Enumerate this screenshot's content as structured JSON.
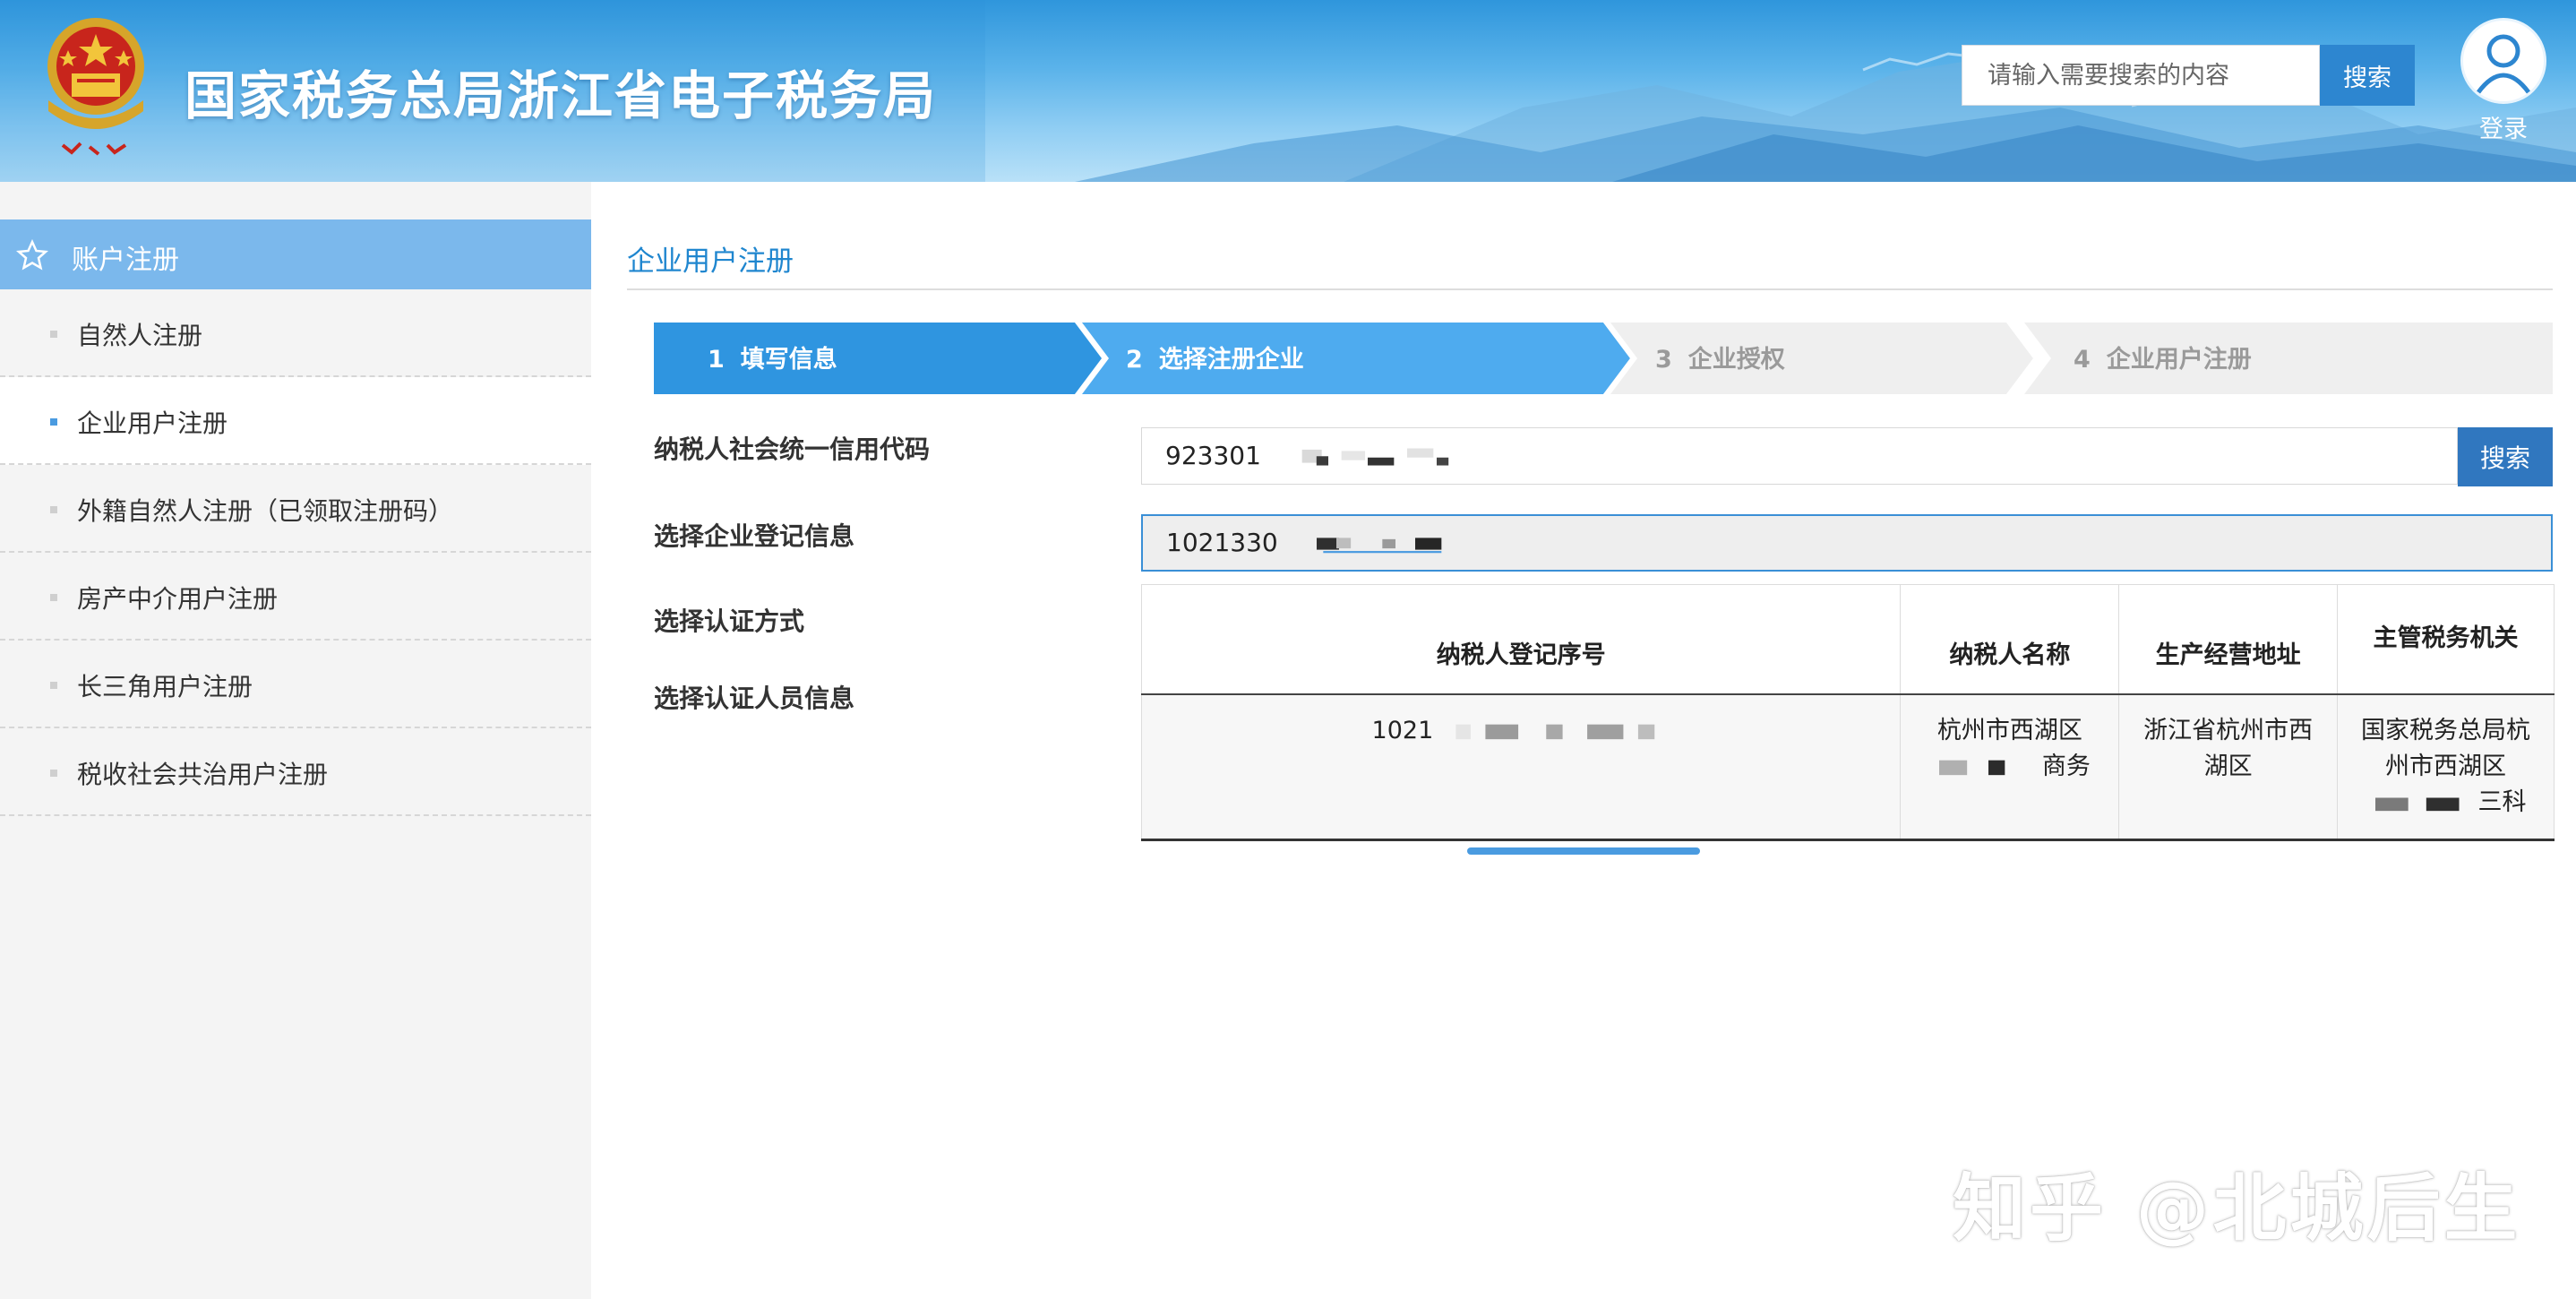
{
  "header": {
    "title": "国家税务总局浙江省电子税务局",
    "search_placeholder": "请输入需要搜索的内容",
    "search_button": "搜索",
    "login_label": "登录"
  },
  "sidebar": {
    "heading": "账户注册",
    "items": [
      {
        "label": "自然人注册",
        "active": false
      },
      {
        "label": "企业用户注册",
        "active": true
      },
      {
        "label": "外籍自然人注册（已领取注册码）",
        "active": false
      },
      {
        "label": "房产中介用户注册",
        "active": false
      },
      {
        "label": "长三角用户注册",
        "active": false
      },
      {
        "label": "税收社会共治用户注册",
        "active": false
      }
    ]
  },
  "main": {
    "section_title": "企业用户注册",
    "steps": [
      {
        "num": "1",
        "label": "填写信息",
        "state": "done"
      },
      {
        "num": "2",
        "label": "选择注册企业",
        "state": "current"
      },
      {
        "num": "3",
        "label": "企业授权",
        "state": "pending"
      },
      {
        "num": "4",
        "label": "企业用户注册",
        "state": "pending"
      }
    ],
    "form": {
      "credit_code_label": "纳税人社会统一信用代码",
      "credit_code_value": "923301",
      "credit_code_search": "搜索",
      "reg_info_label": "选择企业登记信息",
      "reg_info_value": "1021330",
      "auth_method_label": "选择认证方式",
      "auth_person_label": "选择认证人员信息"
    },
    "table": {
      "headers": [
        "纳税人登记序号",
        "纳税人名称",
        "生产经营地址",
        "主管税务机关"
      ],
      "rows": [
        {
          "reg_no": "1021",
          "name_lines": [
            "杭州市西湖区",
            "商务"
          ],
          "address_lines": [
            "浙江省杭州市西",
            "湖区"
          ],
          "authority_lines": [
            "国家税务总局杭",
            "州市西湖区",
            "三科"
          ]
        }
      ]
    }
  },
  "watermark": "知乎 @北城后生",
  "colors": {
    "accent_blue": "#2d86d0",
    "step_done": "#2f95e0",
    "step_current": "#4eabef",
    "step_pending": "#efefef",
    "sidebar_head": "#7bb8ec"
  }
}
